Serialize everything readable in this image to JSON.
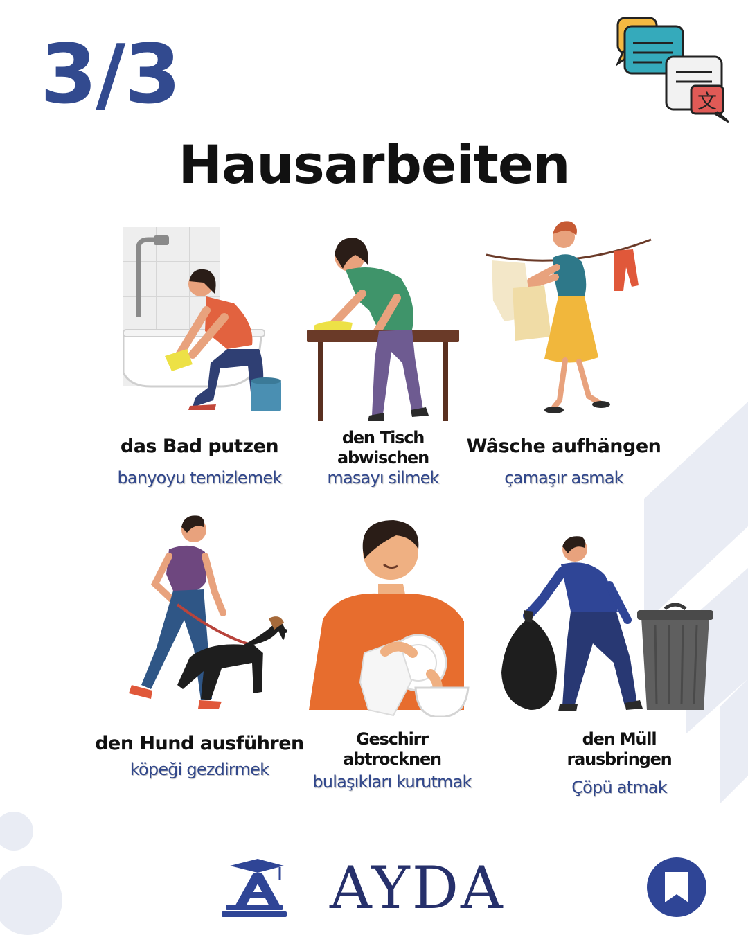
{
  "header": {
    "page_counter": "3/3",
    "title": "Hausarbeiten"
  },
  "cards": [
    {
      "term": "das Bad putzen",
      "translation": "banyoyu temizlemek",
      "illustration_icon": "bathtub-cleaning-icon"
    },
    {
      "term_line1": "den Tisch",
      "term_line2": "abwischen",
      "translation": "masayı silmek",
      "illustration_icon": "table-wiping-icon"
    },
    {
      "term": "Wâsche aufhängen",
      "translation": "çamaşır asmak",
      "illustration_icon": "laundry-hanging-icon"
    },
    {
      "term": "den Hund ausführen",
      "translation": "köpeği gezdirmek",
      "illustration_icon": "dog-walking-icon"
    },
    {
      "term_line1": "Geschirr",
      "term_line2": "abtrocknen",
      "translation": "bulaşıkları kurutmak",
      "illustration_icon": "dish-drying-icon"
    },
    {
      "term_line1": "den Müll",
      "term_line2": "rausbringen",
      "translation": "Çöpü atmak",
      "illustration_icon": "trash-out-icon"
    }
  ],
  "brand": {
    "name": "AYDA",
    "logo_icon": "graduation-cap-logo-icon"
  },
  "actions": {
    "bookmark_icon": "bookmark-icon"
  },
  "colors": {
    "brand_blue": "#324a8f",
    "brand_navy": "#26306b",
    "translation_blue": "#31478b",
    "bookmark_blue": "#2f4596"
  }
}
